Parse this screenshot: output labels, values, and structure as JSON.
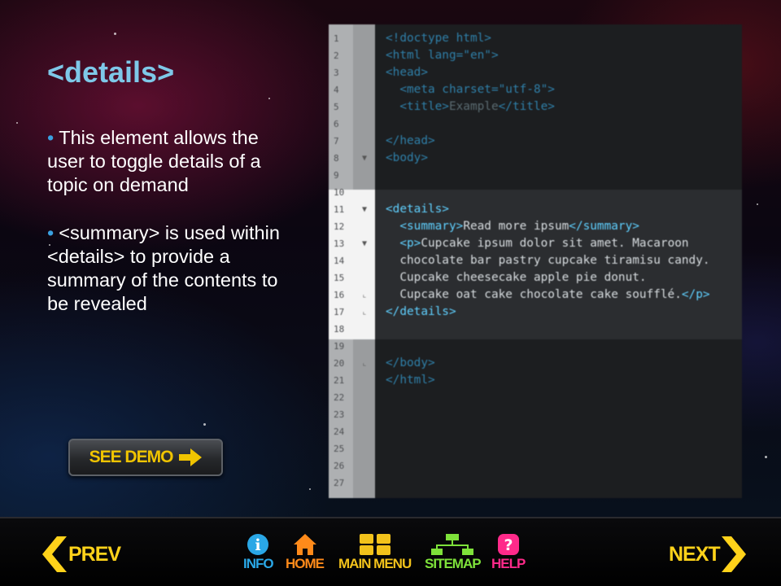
{
  "slide": {
    "title": "<details>",
    "bullets": [
      "This element allows the user to toggle details of a topic on demand",
      "<summary> is used within <details> to provide a summary of the contents to be revealed"
    ],
    "demo_button_label": "SEE DEMO"
  },
  "code": {
    "lines": [
      {
        "n": "1",
        "fold": "",
        "text": "<!doctype html>"
      },
      {
        "n": "2",
        "fold": "",
        "text": "<html lang=\"en\">"
      },
      {
        "n": "3",
        "fold": "",
        "text": "<head>"
      },
      {
        "n": "4",
        "fold": "",
        "text": "  <meta charset=\"utf-8\">"
      },
      {
        "n": "5",
        "fold": "",
        "text": "  <title>Example</title>"
      },
      {
        "n": "6",
        "fold": "",
        "text": ""
      },
      {
        "n": "7",
        "fold": "",
        "text": "</head>"
      },
      {
        "n": "8",
        "fold": "▼",
        "text": "<body>"
      },
      {
        "n": "9",
        "fold": "",
        "text": ""
      },
      {
        "n": "10",
        "fold": "",
        "text": ""
      },
      {
        "n": "11",
        "fold": "▼",
        "text": "<details>"
      },
      {
        "n": "12",
        "fold": "",
        "text": "  <summary>Read more ipsum</summary>"
      },
      {
        "n": "13",
        "fold": "▼",
        "text": "  <p>Cupcake ipsum dolor sit amet. Macaroon"
      },
      {
        "n": "14",
        "fold": "",
        "text": "  chocolate bar pastry cupcake tiramisu candy."
      },
      {
        "n": "15",
        "fold": "",
        "text": "  Cupcake cheesecake apple pie donut."
      },
      {
        "n": "16",
        "fold": "⌞",
        "text": "  Cupcake oat cake chocolate cake soufflé.</p>"
      },
      {
        "n": "17",
        "fold": "⌞",
        "text": "</details>"
      },
      {
        "n": "18",
        "fold": "",
        "text": ""
      },
      {
        "n": "19",
        "fold": "",
        "text": ""
      },
      {
        "n": "20",
        "fold": "⌞",
        "text": "</body>"
      },
      {
        "n": "21",
        "fold": "",
        "text": "</html>"
      },
      {
        "n": "22",
        "fold": "",
        "text": ""
      },
      {
        "n": "23",
        "fold": "",
        "text": ""
      },
      {
        "n": "24",
        "fold": "",
        "text": ""
      },
      {
        "n": "25",
        "fold": "",
        "text": ""
      },
      {
        "n": "26",
        "fold": "",
        "text": ""
      },
      {
        "n": "27",
        "fold": "",
        "text": ""
      }
    ],
    "highlight_range": [
      10,
      18
    ]
  },
  "nav": {
    "prev": "PREV",
    "next": "NEXT",
    "info": "INFO",
    "home": "HOME",
    "main_menu": "MAIN MENU",
    "sitemap": "SITEMAP",
    "help": "HELP",
    "info_glyph": "i",
    "help_glyph": "?"
  },
  "colors": {
    "title": "#7ec8e8",
    "bullet": "#3aa0e0",
    "nav_yellow": "#ffd21a",
    "info_blue": "#2aa7e6",
    "home_orange": "#ff8a1a",
    "sitemap_green": "#7ee23a",
    "help_pink": "#ff2a8a"
  }
}
